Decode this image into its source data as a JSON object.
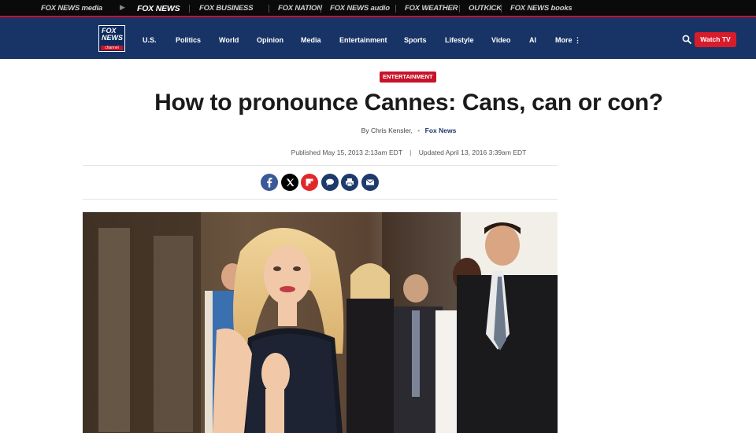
{
  "network_bar": {
    "items": [
      {
        "label": "FOX NEWS media",
        "icon": "fox-news-media-logo"
      },
      {
        "label": "FOX NEWS",
        "icon": "fox-news-logo"
      },
      {
        "label": "FOX BUSINESS",
        "icon": "fox-business-logo"
      },
      {
        "label": "FOX NATION",
        "icon": "fox-nation-logo"
      },
      {
        "label": "FOX NEWS audio",
        "icon": "fox-news-audio-logo"
      },
      {
        "label": "FOX WEATHER",
        "icon": "fox-weather-logo"
      },
      {
        "label": "OUTKICK",
        "icon": "outkick-logo"
      },
      {
        "label": "FOX NEWS books",
        "icon": "fox-news-books-logo"
      }
    ]
  },
  "nav": {
    "logo": {
      "line1": "FOX",
      "line2": "NEWS",
      "line3": "channel"
    },
    "links": [
      "U.S.",
      "Politics",
      "World",
      "Opinion",
      "Media",
      "Entertainment",
      "Sports",
      "Lifestyle",
      "Video",
      "AI",
      "More"
    ],
    "watch_label": "Watch TV"
  },
  "article": {
    "category": "ENTERTAINMENT",
    "headline": "How to pronounce Cannes: Cans, can or con?",
    "byline_prefix": "By",
    "author": "Chris Kensler",
    "byline_sep": ",",
    "source": "Fox News",
    "published": "Published May 15, 2013 2:13am EDT",
    "updated": "Updated April 13, 2016 3:39am EDT",
    "share_icons": [
      "facebook-icon",
      "x-icon",
      "flipboard-icon",
      "comment-icon",
      "print-icon",
      "email-icon"
    ]
  },
  "colors": {
    "topbar": "#0a0a0a",
    "nav": "#183466",
    "accent_red": "#c7122a",
    "watch_button": "#d91c2b",
    "share_dark": "#1d3a6b"
  }
}
